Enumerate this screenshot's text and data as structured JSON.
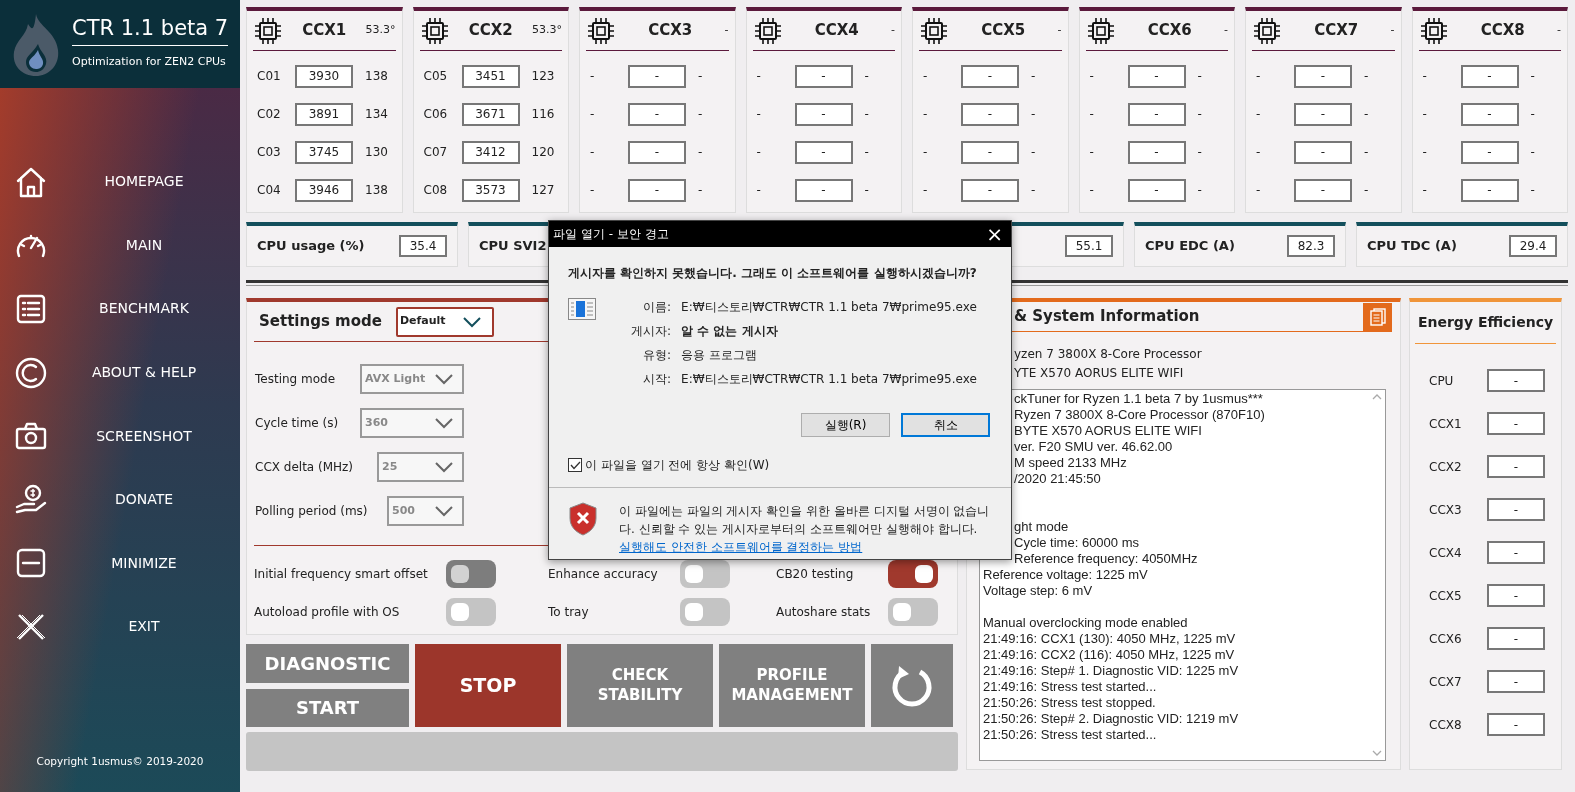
{
  "app": {
    "title": "CTR 1.1 beta 7",
    "subtitle": "Optimization for ZEN2 CPUs"
  },
  "nav": [
    {
      "label": "HOMEPAGE"
    },
    {
      "label": "MAIN"
    },
    {
      "label": "BENCHMARK"
    },
    {
      "label": "ABOUT & HELP"
    },
    {
      "label": "SCREENSHOT"
    },
    {
      "label": "DONATE"
    },
    {
      "label": "MINIMIZE"
    },
    {
      "label": "EXIT"
    }
  ],
  "copyright": "Copyright 1usmus© 2019-2020",
  "ccx": [
    {
      "name": "CCX1",
      "temp": "53.3°",
      "cores": [
        {
          "label": "C01",
          "freq": "3930",
          "value": "138"
        },
        {
          "label": "C02",
          "freq": "3891",
          "value": "134"
        },
        {
          "label": "C03",
          "freq": "3745",
          "value": "130"
        },
        {
          "label": "C04",
          "freq": "3946",
          "value": "138"
        }
      ]
    },
    {
      "name": "CCX2",
      "temp": "53.3°",
      "cores": [
        {
          "label": "C05",
          "freq": "3451",
          "value": "123"
        },
        {
          "label": "C06",
          "freq": "3671",
          "value": "116"
        },
        {
          "label": "C07",
          "freq": "3412",
          "value": "120"
        },
        {
          "label": "C08",
          "freq": "3573",
          "value": "127"
        }
      ]
    },
    {
      "name": "CCX3",
      "temp": "-",
      "cores": [
        {
          "label": "-",
          "freq": "-",
          "value": "-"
        },
        {
          "label": "-",
          "freq": "-",
          "value": "-"
        },
        {
          "label": "-",
          "freq": "-",
          "value": "-"
        },
        {
          "label": "-",
          "freq": "-",
          "value": "-"
        }
      ]
    },
    {
      "name": "CCX4",
      "temp": "-",
      "cores": [
        {
          "label": "-",
          "freq": "-",
          "value": "-"
        },
        {
          "label": "-",
          "freq": "-",
          "value": "-"
        },
        {
          "label": "-",
          "freq": "-",
          "value": "-"
        },
        {
          "label": "-",
          "freq": "-",
          "value": "-"
        }
      ]
    },
    {
      "name": "CCX5",
      "temp": "-",
      "cores": [
        {
          "label": "-",
          "freq": "-",
          "value": "-"
        },
        {
          "label": "-",
          "freq": "-",
          "value": "-"
        },
        {
          "label": "-",
          "freq": "-",
          "value": "-"
        },
        {
          "label": "-",
          "freq": "-",
          "value": "-"
        }
      ]
    },
    {
      "name": "CCX6",
      "temp": "-",
      "cores": [
        {
          "label": "-",
          "freq": "-",
          "value": "-"
        },
        {
          "label": "-",
          "freq": "-",
          "value": "-"
        },
        {
          "label": "-",
          "freq": "-",
          "value": "-"
        },
        {
          "label": "-",
          "freq": "-",
          "value": "-"
        }
      ]
    },
    {
      "name": "CCX7",
      "temp": "-",
      "cores": [
        {
          "label": "-",
          "freq": "-",
          "value": "-"
        },
        {
          "label": "-",
          "freq": "-",
          "value": "-"
        },
        {
          "label": "-",
          "freq": "-",
          "value": "-"
        },
        {
          "label": "-",
          "freq": "-",
          "value": "-"
        }
      ]
    },
    {
      "name": "CCX8",
      "temp": "-",
      "cores": [
        {
          "label": "-",
          "freq": "-",
          "value": "-"
        },
        {
          "label": "-",
          "freq": "-",
          "value": "-"
        },
        {
          "label": "-",
          "freq": "-",
          "value": "-"
        },
        {
          "label": "-",
          "freq": "-",
          "value": "-"
        }
      ]
    }
  ],
  "stats": [
    {
      "label": "CPU usage (%)",
      "value": "35.4"
    },
    {
      "label": "CPU SVI2"
    },
    {
      "value": "55.1"
    },
    {
      "label": "CPU EDC (A)",
      "value": "82.3"
    },
    {
      "label": "CPU TDC (A)",
      "value": "29.4"
    }
  ],
  "settings": {
    "title": "Settings mode",
    "mode": "Default",
    "fields": [
      {
        "label": "Testing mode",
        "value": "AVX Light"
      },
      {
        "label": "Cycle time (s)",
        "value": "360"
      },
      {
        "label": "CCX delta (MHz)",
        "value": "25"
      },
      {
        "label": "Polling period (ms)",
        "value": "500"
      }
    ],
    "toggles": [
      {
        "label": "Initial frequency smart offset",
        "on": false,
        "disabled": true
      },
      {
        "label": "Enhance accuracy",
        "on": false,
        "disabled": false
      },
      {
        "label": "CB20 testing",
        "on": true,
        "disabled": false
      },
      {
        "label": "Autoload profile with OS",
        "on": false,
        "disabled": false
      },
      {
        "label": "To tray",
        "on": false,
        "disabled": false
      },
      {
        "label": "Autoshare stats",
        "on": false,
        "disabled": false
      }
    ]
  },
  "actions": {
    "diagnostic": "DIAGNOSTIC",
    "start": "START",
    "stop": "STOP",
    "check": "CHECK STABILITY",
    "profile": "PROFILE MANAGEMENT"
  },
  "progress": {
    "level": 0
  },
  "system": {
    "title": "& System Information",
    "info": [
      "yzen 7 3800X 8-Core Processor",
      "YTE X570 AORUS ELITE WIFI"
    ],
    "log": [
      [
        "ckTuner for Ryzen 1.1 beta 7 by 1usmus***",
        "Ryzen 7 3800X 8-Core Processor (870F10)",
        "BYTE X570 AORUS ELITE WIFI",
        "ver. F20 SMU ver. 46.62.00",
        "M speed 2133 MHz",
        "/2020 21:45:50"
      ],
      [
        "ght mode",
        "Cycle time: 60000 ms",
        "Reference frequency: 4050MHz",
        "Reference voltage: 1225 mV",
        "Voltage step: 6 mV"
      ],
      [
        "Manual overclocking mode enabled",
        "21:49:16: CCX1 (130): 4050 MHz, 1225 mV",
        "21:49:16: CCX2 (116): 4050 MHz, 1225 mV",
        "21:49:16: Step# 1. Diagnostic VID: 1225 mV",
        "21:49:16: Stress test started...",
        "21:50:26: Stress test stopped.",
        "21:50:26: Step# 2. Diagnostic VID: 1219 mV",
        "21:50:26: Stress test started..."
      ]
    ]
  },
  "energy": {
    "title": "Energy Efficiency",
    "rows": [
      {
        "label": "CPU",
        "value": "-"
      },
      {
        "label": "CCX1",
        "value": "-"
      },
      {
        "label": "CCX2",
        "value": "-"
      },
      {
        "label": "CCX3",
        "value": "-"
      },
      {
        "label": "CCX4",
        "value": "-"
      },
      {
        "label": "CCX5",
        "value": "-"
      },
      {
        "label": "CCX6",
        "value": "-"
      },
      {
        "label": "CCX7",
        "value": "-"
      },
      {
        "label": "CCX8",
        "value": "-"
      }
    ]
  },
  "dialog": {
    "title": "파일 열기 - 보안 경고",
    "close": "×",
    "question": "게시자를 확인하지 못했습니다.  그래도 이 소프트웨어를 실행하시겠습니까?",
    "fields": [
      {
        "label": "이름:",
        "value": "E:₩티스토리₩CTR₩CTR 1.1 beta 7₩prime95.exe",
        "bold": false
      },
      {
        "label": "게시자:",
        "value": "알 수 없는 게시자",
        "bold": true
      },
      {
        "label": "유형:",
        "value": "응용 프로그램",
        "bold": false
      },
      {
        "label": "시작:",
        "value": "E:₩티스토리₩CTR₩CTR 1.1 beta 7₩prime95.exe",
        "bold": false
      }
    ],
    "buttons": [
      {
        "label": "실행(R)",
        "focused": false
      },
      {
        "label": "취소",
        "focused": true
      }
    ],
    "checkbox": {
      "label": "이 파일을 열기 전에 항상 확인(W)",
      "checked": true
    },
    "warning": "이 파일에는 파일의 게시자 확인을 위한 올바른 디지털 서명이 없습니다.  신뢰할 수 있는 게시자로부터의 소프트웨어만 실행해야 합니다.",
    "link": "실행해도 안전한 소프트웨어를 결정하는 방법"
  }
}
